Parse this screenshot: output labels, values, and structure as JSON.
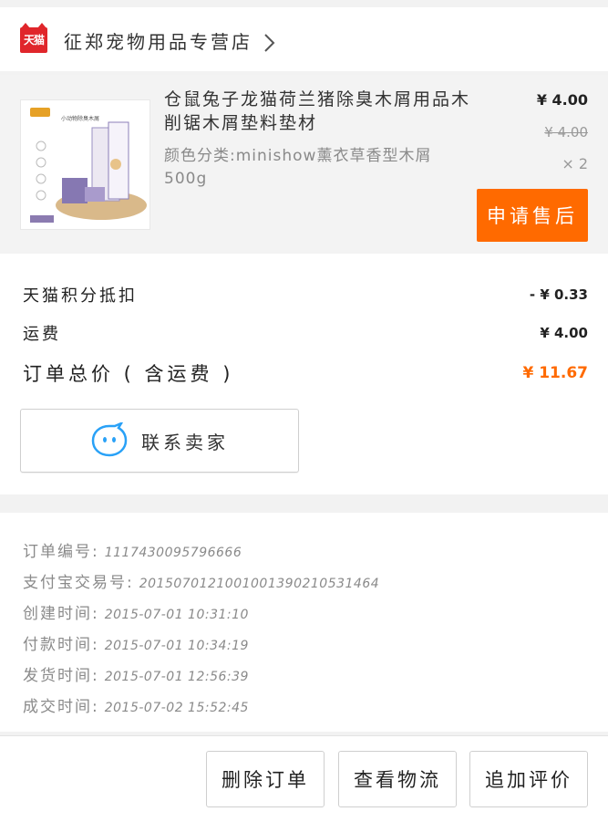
{
  "store": {
    "badge": "天猫",
    "name": "征郑宠物用品专营店"
  },
  "product": {
    "title": "仓鼠兔子龙猫荷兰猪除臭木屑用品木削锯木屑垫料垫材",
    "sku": "颜色分类:minishow薰衣草香型木屑500g",
    "price": "¥ 4.00",
    "original_price": "¥ 4.00",
    "quantity": "× 2",
    "aftersale_label": "申请售后",
    "thumb_text": "小动物除臭木屑"
  },
  "summary": {
    "points_label": "天猫积分抵扣",
    "points_value": "- ¥ 0.33",
    "shipping_label": "运费",
    "shipping_value": "¥ 4.00",
    "total_label": "订单总价 ( 含运费 )",
    "total_value": "¥ 11.67",
    "contact_label": "联系卖家"
  },
  "order_info": [
    {
      "label": "订单编号:",
      "value": "1117430095796666"
    },
    {
      "label": "支付宝交易号:",
      "value": "2015070121001001390210531464"
    },
    {
      "label": "创建时间:",
      "value": "2015-07-01 10:31:10"
    },
    {
      "label": "付款时间:",
      "value": "2015-07-01 10:34:19"
    },
    {
      "label": "发货时间:",
      "value": "2015-07-01 12:56:39"
    },
    {
      "label": "成交时间:",
      "value": "2015-07-02 15:52:45"
    }
  ],
  "footer": {
    "delete_label": "删除订单",
    "logistics_label": "查看物流",
    "review_label": "追加评价"
  },
  "colors": {
    "accent": "#ff6a00",
    "tmall_red": "#e0262b",
    "contact_icon": "#29a1f7"
  }
}
